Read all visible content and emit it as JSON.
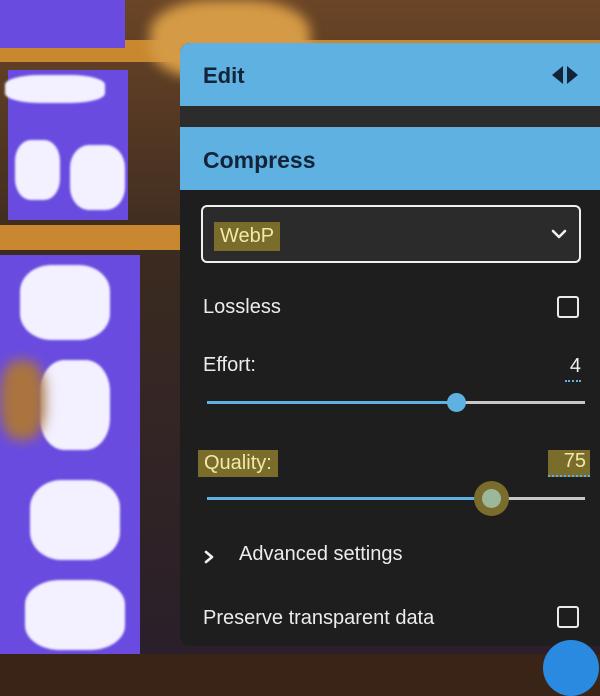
{
  "edit": {
    "title": "Edit"
  },
  "compress": {
    "title": "Compress"
  },
  "format": {
    "selected": "WebP"
  },
  "lossless": {
    "label": "Lossless",
    "checked": false
  },
  "effort": {
    "label": "Effort:",
    "value": "4",
    "level": 0.66
  },
  "quality": {
    "label": "Quality:",
    "value": "75",
    "level": 0.75
  },
  "advanced": {
    "label": "Advanced settings"
  },
  "preserve": {
    "label": "Preserve transparent data",
    "checked": false
  },
  "icons": {
    "toggle": "left-right-arrows-icon",
    "dropdown": "chevron-down-icon",
    "expand": "chevron-right-icon"
  },
  "colors": {
    "header": "#5fb1e2",
    "panel": "#1e1e1e",
    "highlight": "#7a6d2c"
  }
}
